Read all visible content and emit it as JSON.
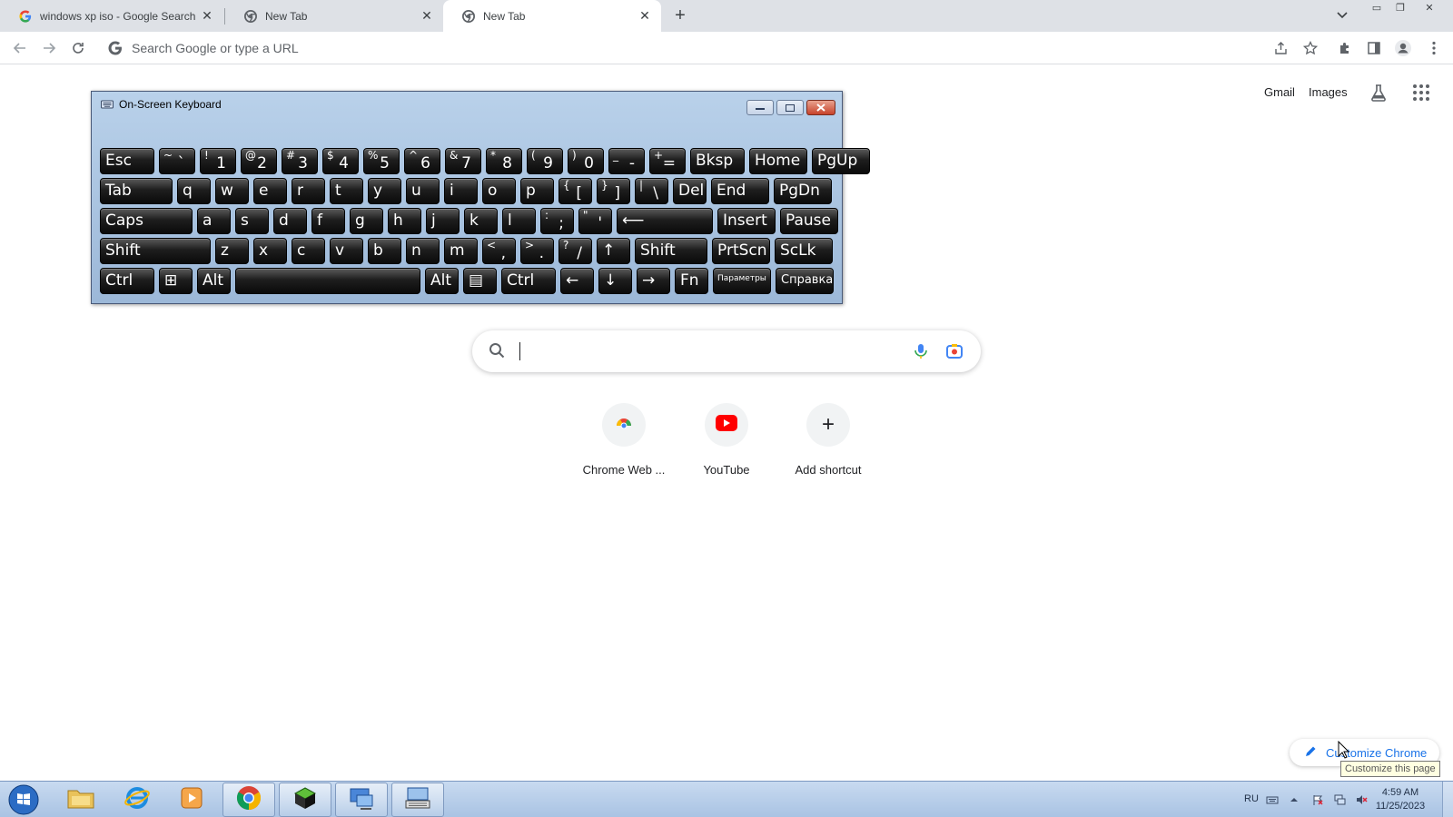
{
  "tabs": [
    {
      "title": "windows xp iso - Google Search",
      "favicon": "google-g-icon",
      "active": false
    },
    {
      "title": "New Tab",
      "favicon": "chrome-icon",
      "active": false
    },
    {
      "title": "New Tab",
      "favicon": "chrome-icon",
      "active": true
    }
  ],
  "toolbar": {
    "omnibox_placeholder": "Search Google or type a URL"
  },
  "ntp": {
    "gmail": "Gmail",
    "images": "Images",
    "shortcuts": [
      {
        "label": "Chrome Web ...",
        "icon": "chrome-web-store-icon"
      },
      {
        "label": "YouTube",
        "icon": "youtube-icon"
      },
      {
        "label": "Add shortcut",
        "icon": "plus-icon"
      }
    ],
    "customize_label": "Customize Chrome",
    "customize_tooltip": "Customize this page"
  },
  "osk": {
    "title": "On-Screen Keyboard",
    "rows": [
      [
        {
          "main": "Esc"
        },
        {
          "shift": "~",
          "base": "`"
        },
        {
          "shift": "!",
          "base": "1"
        },
        {
          "shift": "@",
          "base": "2"
        },
        {
          "shift": "#",
          "base": "3"
        },
        {
          "shift": "$",
          "base": "4"
        },
        {
          "shift": "%",
          "base": "5"
        },
        {
          "shift": "^",
          "base": "6"
        },
        {
          "shift": "&",
          "base": "7"
        },
        {
          "shift": "*",
          "base": "8"
        },
        {
          "shift": "(",
          "base": "9"
        },
        {
          "shift": ")",
          "base": "0"
        },
        {
          "shift": "_",
          "base": "-"
        },
        {
          "shift": "+",
          "base": "="
        },
        {
          "main": "Bksp"
        },
        {
          "main": "Home"
        },
        {
          "main": "PgUp"
        }
      ],
      [
        {
          "main": "Tab"
        },
        {
          "main": "q"
        },
        {
          "main": "w"
        },
        {
          "main": "e"
        },
        {
          "main": "r"
        },
        {
          "main": "t"
        },
        {
          "main": "y"
        },
        {
          "main": "u"
        },
        {
          "main": "i"
        },
        {
          "main": "o"
        },
        {
          "main": "p"
        },
        {
          "shift": "{",
          "base": "["
        },
        {
          "shift": "}",
          "base": "]"
        },
        {
          "shift": "|",
          "base": "\\"
        },
        {
          "main": "Del"
        },
        {
          "main": "End"
        },
        {
          "main": "PgDn"
        }
      ],
      [
        {
          "main": "Caps"
        },
        {
          "main": "a"
        },
        {
          "main": "s"
        },
        {
          "main": "d"
        },
        {
          "main": "f"
        },
        {
          "main": "g"
        },
        {
          "main": "h"
        },
        {
          "main": "j"
        },
        {
          "main": "k"
        },
        {
          "main": "l"
        },
        {
          "shift": ":",
          "base": ";"
        },
        {
          "shift": "\"",
          "base": "'"
        },
        {
          "main": "⟵"
        },
        {
          "main": "Insert"
        },
        {
          "main": "Pause"
        }
      ],
      [
        {
          "main": "Shift"
        },
        {
          "main": "z"
        },
        {
          "main": "x"
        },
        {
          "main": "c"
        },
        {
          "main": "v"
        },
        {
          "main": "b"
        },
        {
          "main": "n"
        },
        {
          "main": "m"
        },
        {
          "shift": "<",
          "base": ","
        },
        {
          "shift": ">",
          "base": "."
        },
        {
          "shift": "?",
          "base": "/"
        },
        {
          "main": "↑"
        },
        {
          "main": "Shift"
        },
        {
          "main": "PrtScn"
        },
        {
          "main": "ScLk"
        }
      ],
      [
        {
          "main": "Ctrl"
        },
        {
          "main": "⊞"
        },
        {
          "main": "Alt"
        },
        {
          "main": ""
        },
        {
          "main": "Alt"
        },
        {
          "main": "▤"
        },
        {
          "main": "Ctrl"
        },
        {
          "main": "←"
        },
        {
          "main": "↓"
        },
        {
          "main": "→"
        },
        {
          "main": "Fn"
        },
        {
          "small": "Параметры"
        },
        {
          "main": "Справка",
          "medium": true
        }
      ]
    ]
  },
  "taskbar": {
    "items": [
      "file-explorer-icon",
      "internet-explorer-icon",
      "media-player-icon",
      "chrome-icon",
      "box-app-icon",
      "remote-desktop-icon",
      "on-screen-keyboard-icon"
    ],
    "lang": "RU",
    "time": "4:59 AM",
    "date": "11/25/2023"
  }
}
